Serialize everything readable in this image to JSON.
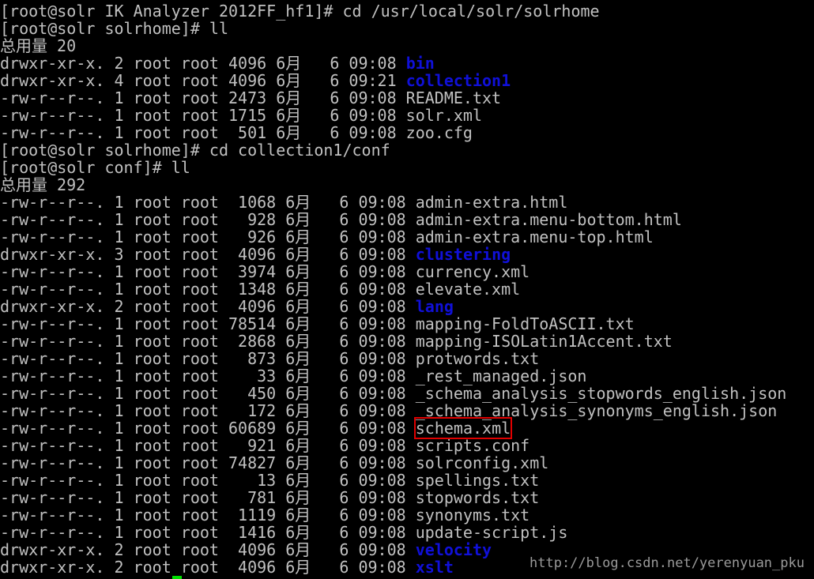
{
  "terminal": {
    "lines": [
      [
        {
          "text": "[root@solr IK Analyzer 2012FF_hf1]# cd /usr/local/solr/solrhome"
        }
      ],
      [
        {
          "text": "[root@solr solrhome]# ll"
        }
      ],
      [
        {
          "text": "总用量 20"
        }
      ],
      [
        {
          "text": "drwxr-xr-x. 2 root root 4096 6月   6 09:08 "
        },
        {
          "text": "bin",
          "cls": "dir"
        }
      ],
      [
        {
          "text": "drwxr-xr-x. 4 root root 4096 6月   6 09:21 "
        },
        {
          "text": "collection1",
          "cls": "dir"
        }
      ],
      [
        {
          "text": "-rw-r--r--. 1 root root 2473 6月   6 09:08 README.txt"
        }
      ],
      [
        {
          "text": "-rw-r--r--. 1 root root 1715 6月   6 09:08 solr.xml"
        }
      ],
      [
        {
          "text": "-rw-r--r--. 1 root root  501 6月   6 09:08 zoo.cfg"
        }
      ],
      [
        {
          "text": "[root@solr solrhome]# cd collection1/conf"
        }
      ],
      [
        {
          "text": "[root@solr conf]# ll"
        }
      ],
      [
        {
          "text": "总用量 292"
        }
      ],
      [
        {
          "text": "-rw-r--r--. 1 root root  1068 6月   6 09:08 admin-extra.html"
        }
      ],
      [
        {
          "text": "-rw-r--r--. 1 root root   928 6月   6 09:08 admin-extra.menu-bottom.html"
        }
      ],
      [
        {
          "text": "-rw-r--r--. 1 root root   926 6月   6 09:08 admin-extra.menu-top.html"
        }
      ],
      [
        {
          "text": "drwxr-xr-x. 3 root root  4096 6月   6 09:08 "
        },
        {
          "text": "clustering",
          "cls": "dir"
        }
      ],
      [
        {
          "text": "-rw-r--r--. 1 root root  3974 6月   6 09:08 currency.xml"
        }
      ],
      [
        {
          "text": "-rw-r--r--. 1 root root  1348 6月   6 09:08 elevate.xml"
        }
      ],
      [
        {
          "text": "drwxr-xr-x. 2 root root  4096 6月   6 09:08 "
        },
        {
          "text": "lang",
          "cls": "dir"
        }
      ],
      [
        {
          "text": "-rw-r--r--. 1 root root 78514 6月   6 09:08 mapping-FoldToASCII.txt"
        }
      ],
      [
        {
          "text": "-rw-r--r--. 1 root root  2868 6月   6 09:08 mapping-ISOLatin1Accent.txt"
        }
      ],
      [
        {
          "text": "-rw-r--r--. 1 root root   873 6月   6 09:08 protwords.txt"
        }
      ],
      [
        {
          "text": "-rw-r--r--. 1 root root    33 6月   6 09:08 _rest_managed.json"
        }
      ],
      [
        {
          "text": "-rw-r--r--. 1 root root   450 6月   6 09:08 _schema_analysis_stopwords_english.json"
        }
      ],
      [
        {
          "text": "-rw-r--r--. 1 root root   172 6月   6 09:08 _schema_analysis_synonyms_english.json"
        }
      ],
      [
        {
          "text": "-rw-r--r--. 1 root root 60689 6月   6 09:08 "
        },
        {
          "text": "schema.xml",
          "cls": "hl"
        }
      ],
      [
        {
          "text": "-rw-r--r--. 1 root root   921 6月   6 09:08 scripts.conf"
        }
      ],
      [
        {
          "text": "-rw-r--r--. 1 root root 74827 6月   6 09:08 solrconfig.xml"
        }
      ],
      [
        {
          "text": "-rw-r--r--. 1 root root    13 6月   6 09:08 spellings.txt"
        }
      ],
      [
        {
          "text": "-rw-r--r--. 1 root root   781 6月   6 09:08 stopwords.txt"
        }
      ],
      [
        {
          "text": "-rw-r--r--. 1 root root  1119 6月   6 09:08 synonyms.txt"
        }
      ],
      [
        {
          "text": "-rw-r--r--. 1 root root  1416 6月   6 09:08 update-script.js"
        }
      ],
      [
        {
          "text": "drwxr-xr-x. 2 root root  4096 6月   6 09:08 "
        },
        {
          "text": "velocity",
          "cls": "dir"
        }
      ],
      [
        {
          "text": "drwxr-xr-x. 2 root root  4096 6月   6 09:08 "
        },
        {
          "text": "xslt",
          "cls": "dir"
        }
      ]
    ]
  },
  "watermark": "http://blog.csdn.net/yerenyuan_pku",
  "colors": {
    "background": "#000000",
    "text": "#c0c0c0",
    "directory": "#1010d8",
    "highlight_box": "#e00000",
    "cursor": "#00e000"
  }
}
